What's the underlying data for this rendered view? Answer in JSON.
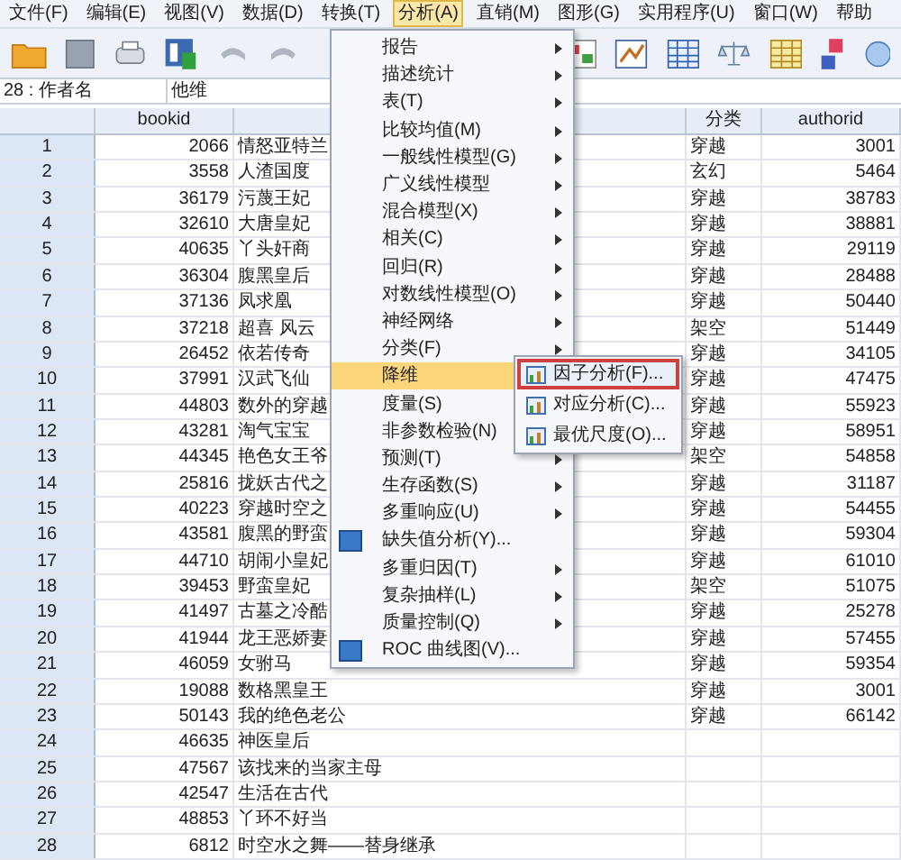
{
  "menu_bar": [
    {
      "label": "文件(F)",
      "selected": false
    },
    {
      "label": "编辑(E)",
      "selected": false
    },
    {
      "label": "视图(V)",
      "selected": false
    },
    {
      "label": "数据(D)",
      "selected": false
    },
    {
      "label": "转换(T)",
      "selected": false
    },
    {
      "label": "分析(A)",
      "selected": true
    },
    {
      "label": "直销(M)",
      "selected": false
    },
    {
      "label": "图形(G)",
      "selected": false
    },
    {
      "label": "实用程序(U)",
      "selected": false
    },
    {
      "label": "窗口(W)",
      "selected": false
    },
    {
      "label": "帮助",
      "selected": false
    }
  ],
  "cell_editor": {
    "cell": "28 : 作者名",
    "value": "他维"
  },
  "table": {
    "columns": [
      "",
      "bookid",
      "",
      "分类",
      "authorid"
    ],
    "rows": [
      [
        "1",
        "2066",
        "情怒亚特兰",
        "穿越",
        "3001"
      ],
      [
        "2",
        "3558",
        "人渣国度",
        "玄幻",
        "5464"
      ],
      [
        "3",
        "36179",
        "污蔑王妃",
        "穿越",
        "38783"
      ],
      [
        "4",
        "32610",
        "大唐皇妃",
        "穿越",
        "38881"
      ],
      [
        "5",
        "40635",
        "丫头奸商",
        "穿越",
        "29119"
      ],
      [
        "6",
        "36304",
        "腹黑皇后",
        "穿越",
        "28488"
      ],
      [
        "7",
        "37136",
        "凤求凰",
        "穿越",
        "50440"
      ],
      [
        "8",
        "37218",
        "超喜 风云",
        "架空",
        "51449"
      ],
      [
        "9",
        "26452",
        "依若传奇",
        "穿越",
        "34105"
      ],
      [
        "10",
        "37991",
        "汉武飞仙",
        "穿越",
        "47475"
      ],
      [
        "11",
        "44803",
        "数外的穿越",
        "穿越",
        "55923"
      ],
      [
        "12",
        "43281",
        "淘气宝宝",
        "穿越",
        "58951"
      ],
      [
        "13",
        "44345",
        "艳色女王爷",
        "架空",
        "54858"
      ],
      [
        "14",
        "25816",
        "拢妖古代之",
        "穿越",
        "31187"
      ],
      [
        "15",
        "40223",
        "穿越时空之",
        "穿越",
        "54455"
      ],
      [
        "16",
        "43581",
        "腹黑的野蛮",
        "穿越",
        "59304"
      ],
      [
        "17",
        "44710",
        "胡闹小皇妃",
        "穿越",
        "61010"
      ],
      [
        "18",
        "39453",
        "野蛮皇妃",
        "架空",
        "51075"
      ],
      [
        "19",
        "41497",
        "古墓之冷酷",
        "穿越",
        "25278"
      ],
      [
        "20",
        "41944",
        "龙王恶娇妻",
        "穿越",
        "57455"
      ],
      [
        "21",
        "46059",
        "女驸马",
        "穿越",
        "59354"
      ],
      [
        "22",
        "19088",
        "数格黑皇王",
        "穿越",
        "3001"
      ],
      [
        "23",
        "50143",
        "我的绝色老公",
        "穿越",
        "66142"
      ],
      [
        "24",
        "46635",
        "神医皇后",
        "",
        ""
      ],
      [
        "25",
        "47567",
        "该找来的当家主母",
        "",
        ""
      ],
      [
        "26",
        "42547",
        "生活在古代",
        "",
        ""
      ],
      [
        "27",
        "48853",
        "丫环不好当",
        "",
        ""
      ],
      [
        "28",
        "6812",
        "时空水之舞——替身继承",
        "",
        ""
      ]
    ]
  },
  "analyze_menu": [
    {
      "label": "报告",
      "kind": "submenu",
      "selected": false
    },
    {
      "label": "描述统计",
      "kind": "submenu",
      "selected": false
    },
    {
      "label": "表(T)",
      "kind": "submenu",
      "selected": false
    },
    {
      "label": "比较均值(M)",
      "kind": "submenu",
      "selected": false
    },
    {
      "label": "一般线性模型(G)",
      "kind": "submenu",
      "selected": false
    },
    {
      "label": "广义线性模型",
      "kind": "submenu",
      "selected": false
    },
    {
      "label": "混合模型(X)",
      "kind": "submenu",
      "selected": false
    },
    {
      "label": "相关(C)",
      "kind": "submenu",
      "selected": false
    },
    {
      "label": "回归(R)",
      "kind": "submenu",
      "selected": false
    },
    {
      "label": "对数线性模型(O)",
      "kind": "submenu",
      "selected": false
    },
    {
      "label": "神经网络",
      "kind": "submenu",
      "selected": false
    },
    {
      "label": "分类(F)",
      "kind": "submenu",
      "selected": false
    },
    {
      "label": "降维",
      "kind": "submenu",
      "selected": true
    },
    {
      "label": "度量(S)",
      "kind": "submenu",
      "selected": false
    },
    {
      "label": "非参数检验(N)",
      "kind": "submenu",
      "selected": false
    },
    {
      "label": "预测(T)",
      "kind": "submenu",
      "selected": false
    },
    {
      "label": "生存函数(S)",
      "kind": "submenu",
      "selected": false
    },
    {
      "label": "多重响应(U)",
      "kind": "submenu",
      "selected": false
    },
    {
      "label": "缺失值分析(Y)...",
      "kind": "command",
      "selected": false
    },
    {
      "label": "多重归因(T)",
      "kind": "submenu",
      "selected": false
    },
    {
      "label": "复杂抽样(L)",
      "kind": "submenu",
      "selected": false
    },
    {
      "label": "质量控制(Q)",
      "kind": "submenu",
      "selected": false
    },
    {
      "label": "ROC 曲线图(V)...",
      "kind": "command",
      "selected": false
    }
  ],
  "reduction_submenu": [
    {
      "label": "因子分析(F)...",
      "selected": true
    },
    {
      "label": "对应分析(C)...",
      "selected": false
    },
    {
      "label": "最优尺度(O)...",
      "selected": false
    }
  ]
}
